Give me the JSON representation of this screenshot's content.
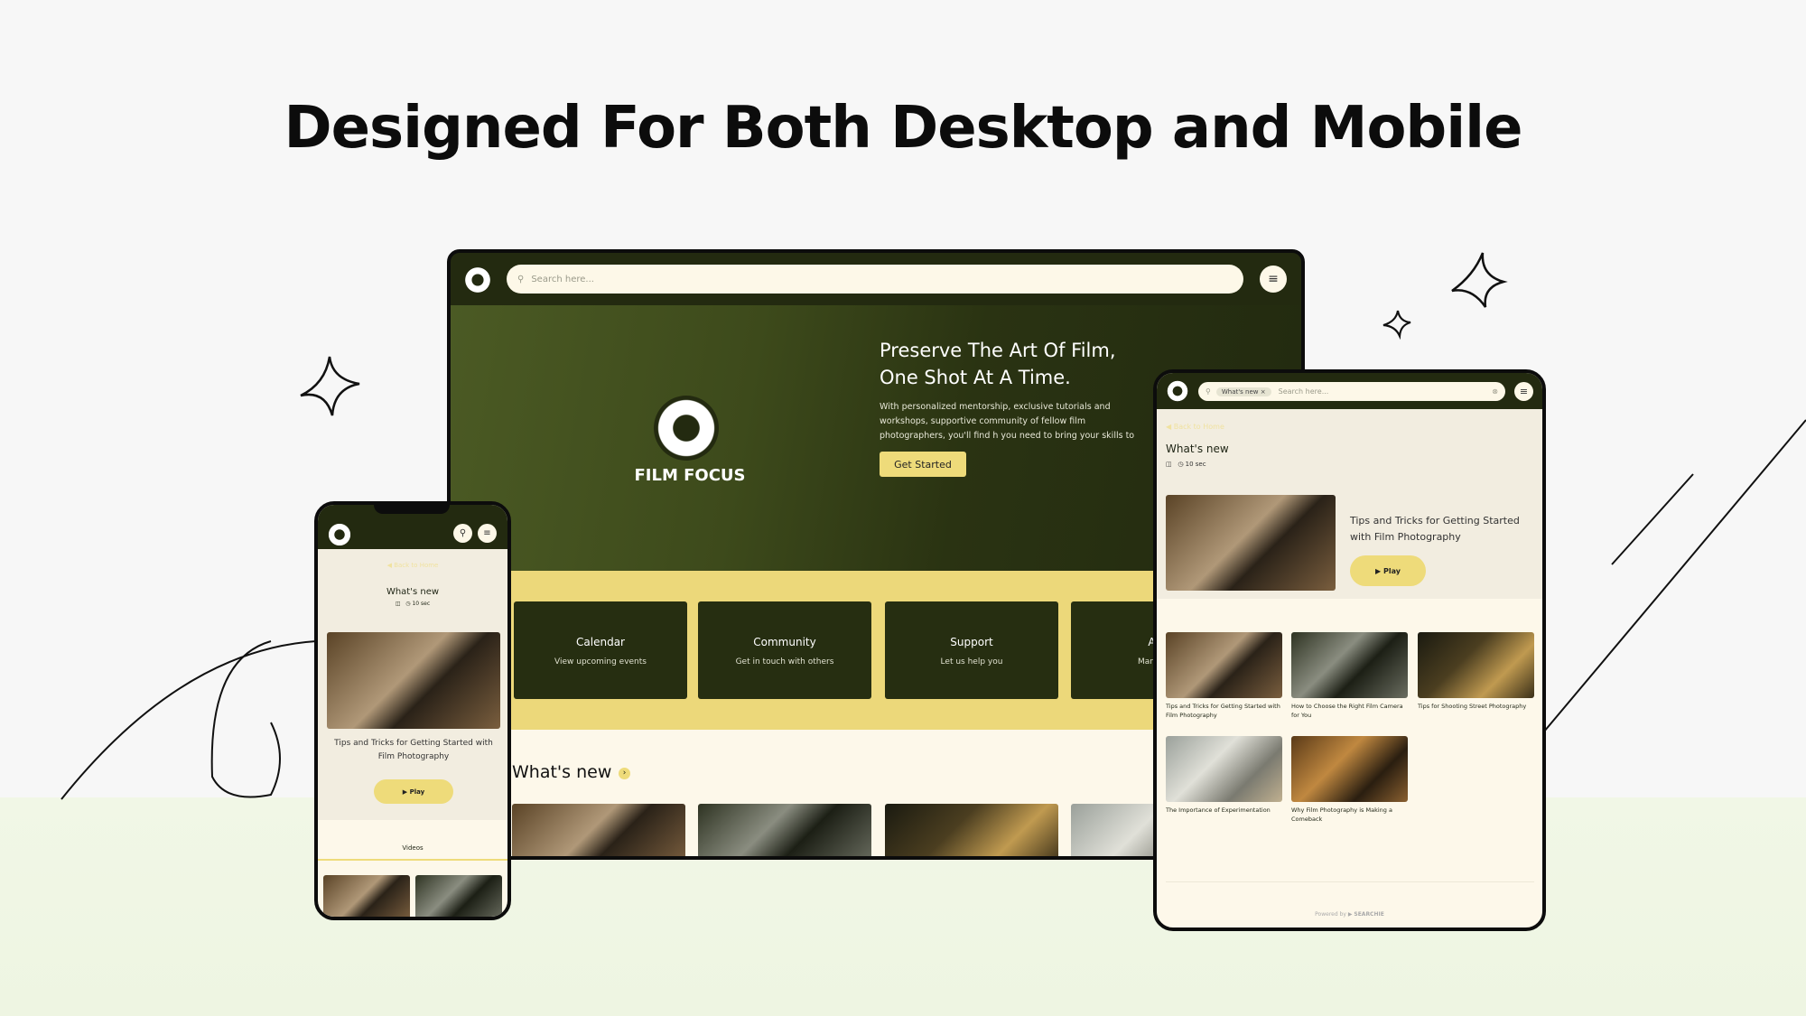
{
  "headline": "Designed For Both Desktop and Mobile",
  "desktop": {
    "search_placeholder": "Search here...",
    "brand": "FILM FOCUS",
    "hero_title": "Preserve The Art Of Film, One Shot At A Time.",
    "hero_body": "With personalized mentorship, exclusive tutorials and workshops, supportive community of fellow film photographers, you'll find h you need to bring your skills to the next level.",
    "cta": "Get Started",
    "cards": [
      {
        "title": "Calendar",
        "subtitle": "View upcoming events"
      },
      {
        "title": "Community",
        "subtitle": "Get in touch with others"
      },
      {
        "title": "Support",
        "subtitle": "Let us help you"
      },
      {
        "title": "Acc",
        "subtitle": "Manage y"
      }
    ],
    "section_title": "What's new"
  },
  "tablet": {
    "search_chip": "What's new",
    "search_placeholder": "Search here...",
    "back": "Back to Home",
    "title": "What's new",
    "duration": "10 sec",
    "featured_title": "Tips and Tricks for Getting Started with Film Photography",
    "play": "Play",
    "videos": [
      "Tips and Tricks for Getting Started with Film Photography",
      "How to Choose the Right Film Camera for You",
      "Tips for Shooting Street Photography",
      "The Importance of Experimentation",
      "Why Film Photography is Making a Comeback"
    ],
    "powered_by": "Powered by",
    "powered_brand": "SEARCHIE"
  },
  "phone": {
    "back": "Back to Home",
    "title": "What's new",
    "duration": "10 sec",
    "featured_title": "Tips and Tricks for Getting Started with Film Photography",
    "play": "Play",
    "tab": "Videos"
  },
  "colors": {
    "dark_green": "#232a10",
    "accent_yellow": "#eedb7a",
    "cream": "#fdf8ea"
  }
}
